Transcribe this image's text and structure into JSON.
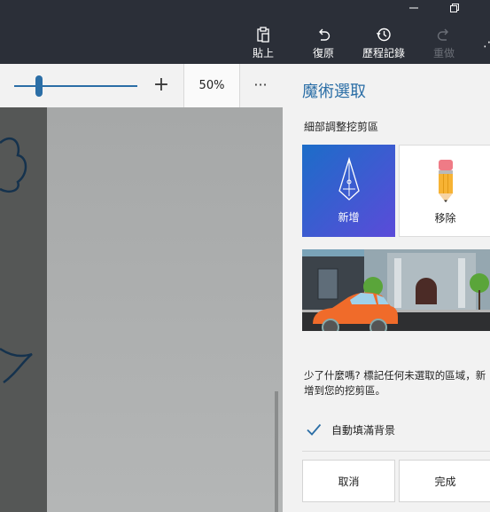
{
  "command_bar": {
    "items": [
      {
        "label": "貼上",
        "icon": "paste-icon"
      },
      {
        "label": "復原",
        "icon": "undo-icon"
      },
      {
        "label": "歷程記錄",
        "icon": "history-icon"
      },
      {
        "label": "重做",
        "icon": "redo-icon",
        "disabled": true
      }
    ]
  },
  "zoom": {
    "value": "50%",
    "plus": "+",
    "more": "···",
    "level": 0.2
  },
  "panel": {
    "title": "魔術選取",
    "subtitle": "細部調整挖剪區",
    "tiles": [
      {
        "label": "新增",
        "icon": "pen-add-icon"
      },
      {
        "label": "移除",
        "icon": "eraser-pencil-icon"
      }
    ],
    "hint_line1": "少了什麼嗎? 標記任何未選取的區域，新",
    "hint_line2": "增到您的挖剪區。",
    "auto_fill_label": "自動填滿背景",
    "auto_fill_checked": true,
    "cancel_label": "取消",
    "done_label": "完成"
  },
  "colors": {
    "accent": "#2b6ea6",
    "titlebar": "#2b2f38",
    "tile_gradient_start": "#1c6dc8",
    "tile_gradient_end": "#5b4bd9"
  }
}
